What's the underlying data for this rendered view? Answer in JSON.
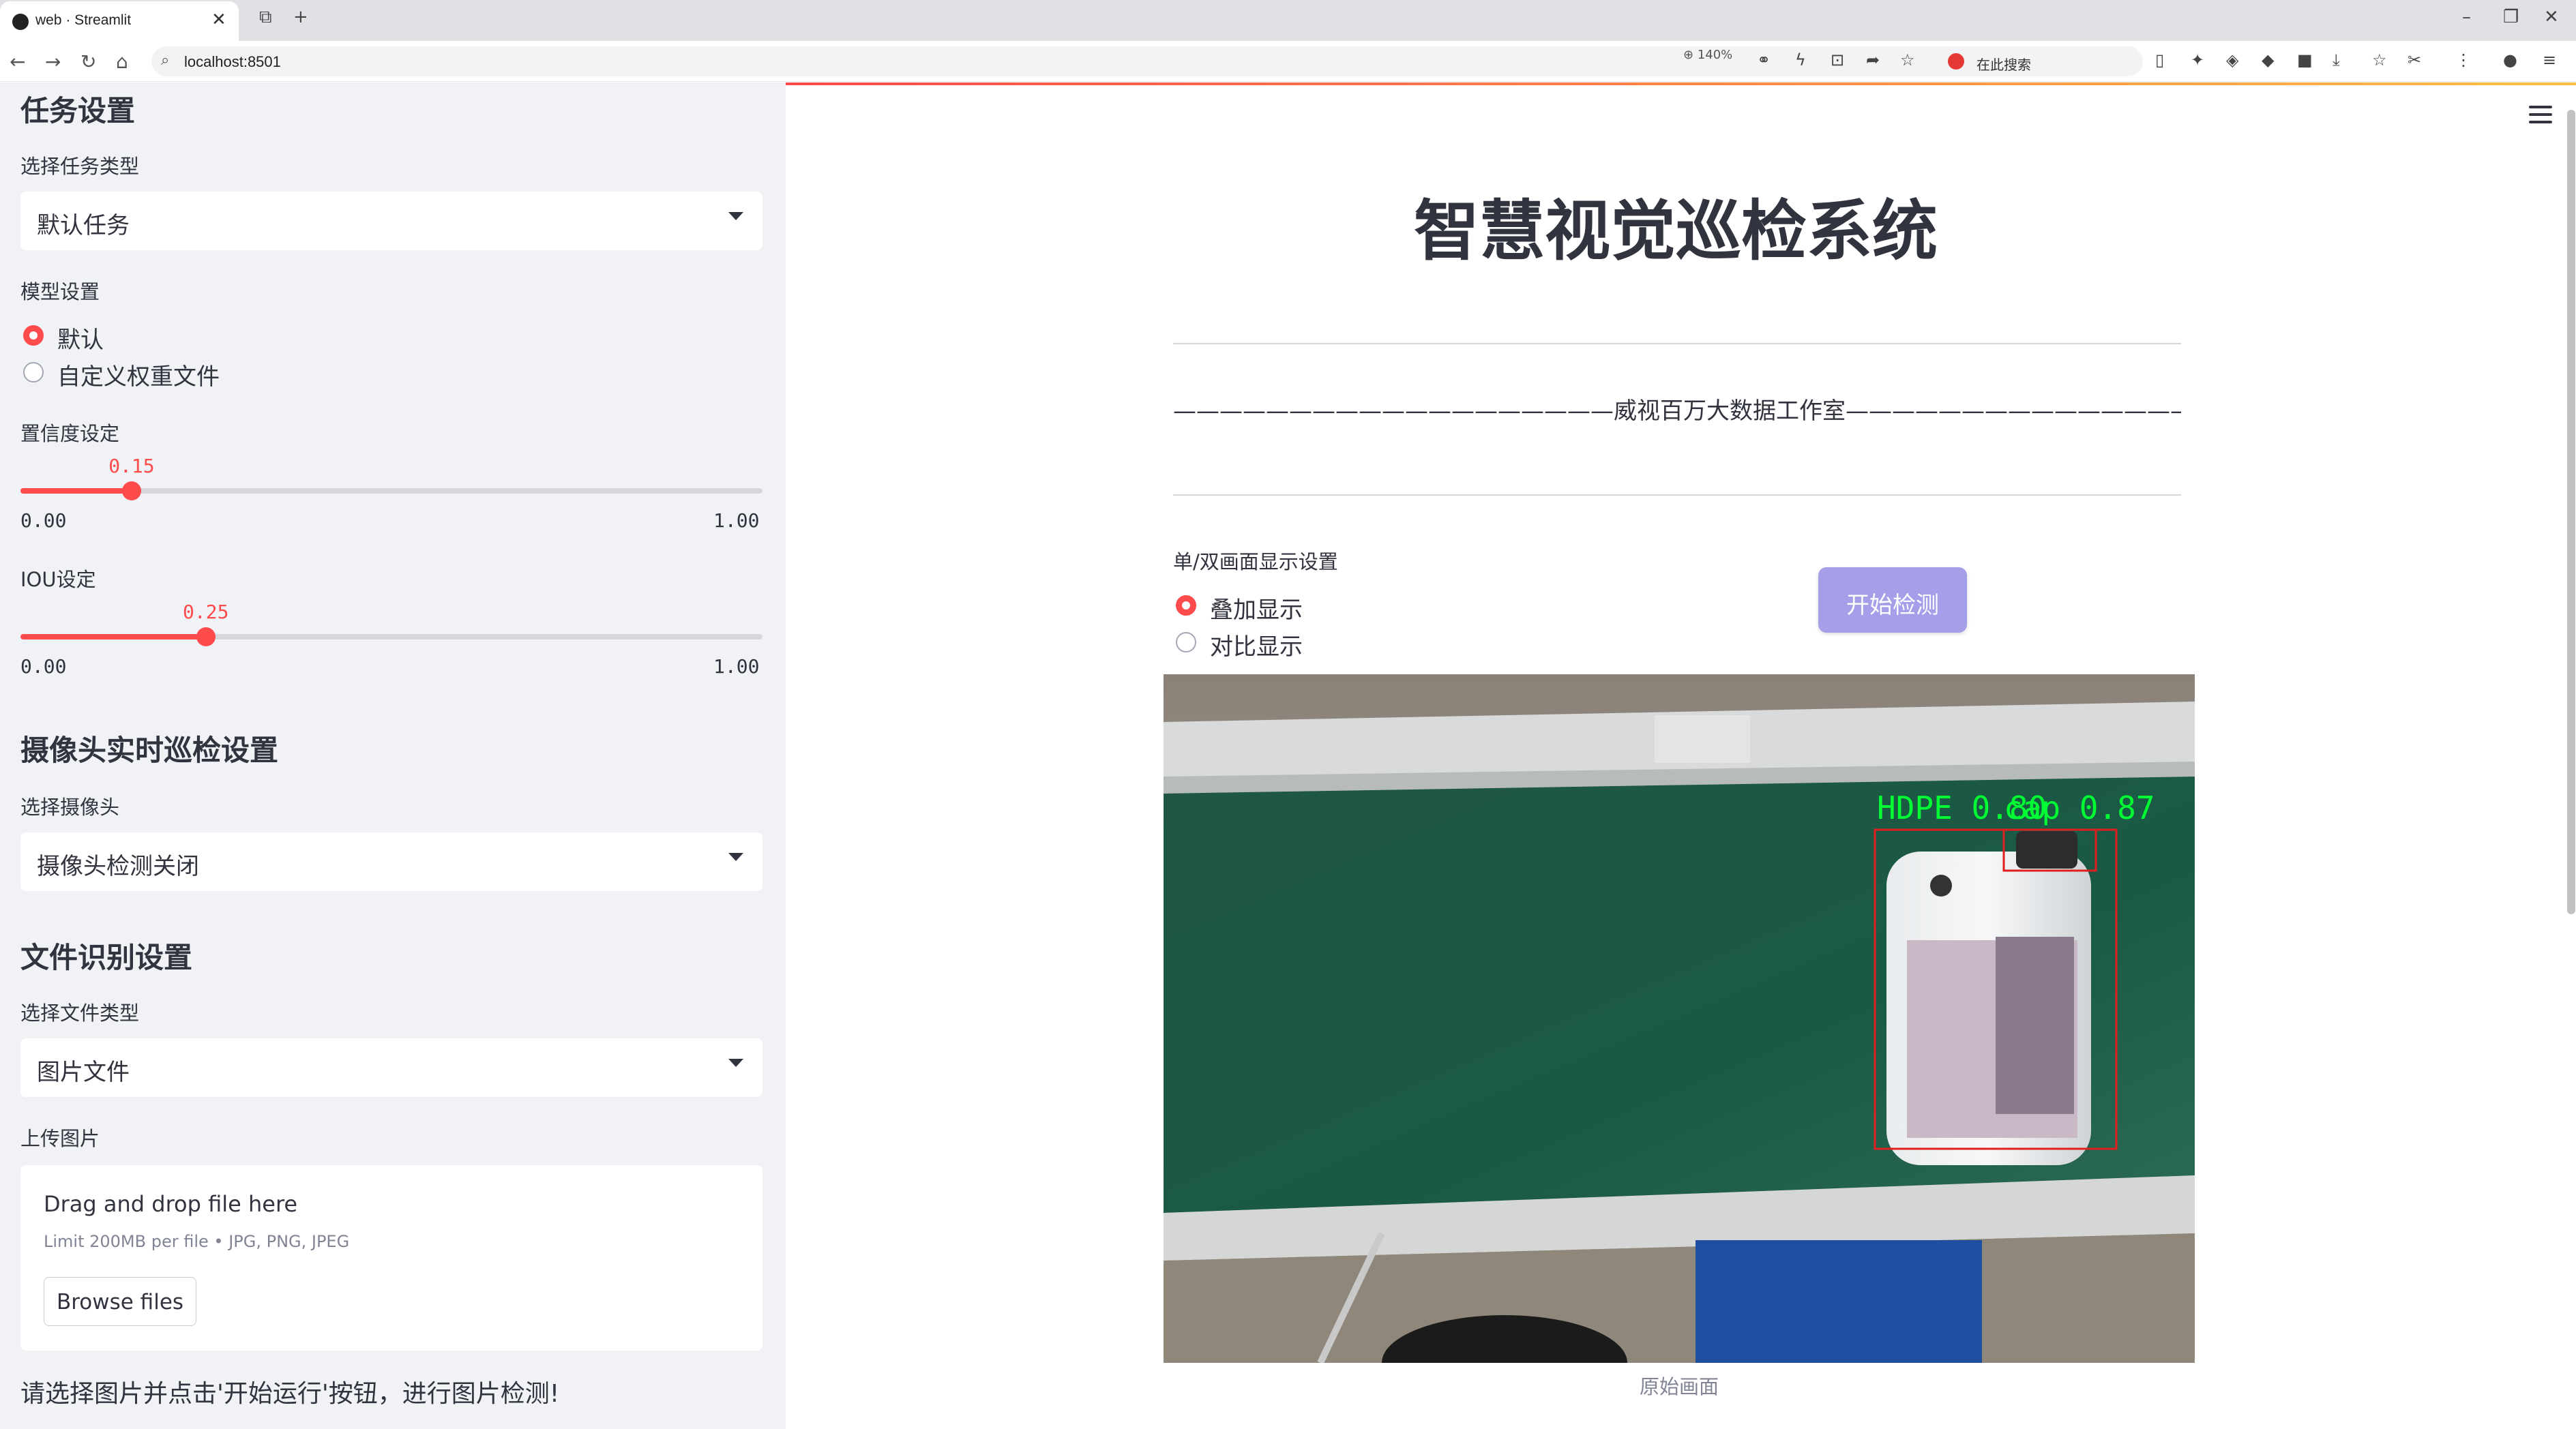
{
  "browser": {
    "tab_title": "web · Streamlit",
    "url": "localhost:8501",
    "zoom": "140%",
    "search_placeholder": "在此搜索"
  },
  "sidebar": {
    "task_heading": "任务设置",
    "task_type_label": "选择任务类型",
    "task_type_value": "默认任务",
    "model_label": "模型设置",
    "model_options": [
      "默认",
      "自定义权重文件"
    ],
    "model_selected": 0,
    "conf_label": "置信度设定",
    "conf_value": "0.15",
    "conf_min": "0.00",
    "conf_max": "1.00",
    "conf_fraction": 0.15,
    "iou_label": "IOU设定",
    "iou_value": "0.25",
    "iou_min": "0.00",
    "iou_max": "1.00",
    "iou_fraction": 0.25,
    "camera_heading": "摄像头实时巡检设置",
    "camera_label": "选择摄像头",
    "camera_value": "摄像头检测关闭",
    "file_heading": "文件识别设置",
    "file_type_label": "选择文件类型",
    "file_type_value": "图片文件",
    "upload_label": "上传图片",
    "upload_title": "Drag and drop file here",
    "upload_limit": "Limit 200MB per file • JPG, PNG, JPEG",
    "browse_label": "Browse files",
    "note": "请选择图片并点击'开始运行'按钮，进行图片检测!"
  },
  "main": {
    "title": "智慧视觉巡检系统",
    "studio": "———————————————————威视百万大数据工作室————————————————————",
    "display_label": "单/双画面显示设置",
    "display_options": [
      "叠加显示",
      "对比显示"
    ],
    "display_selected": 0,
    "start_button": "开始检测",
    "detection_label_1": "HDPE 0.80",
    "detection_label_2": "cap 0.87",
    "caption": "原始画面"
  },
  "colors": {
    "accent": "#ff4b4b",
    "sidebar_bg": "#f0f2f6",
    "button": "#a59ee8",
    "detection_box": "#e02020",
    "detection_text": "#00ff33"
  }
}
